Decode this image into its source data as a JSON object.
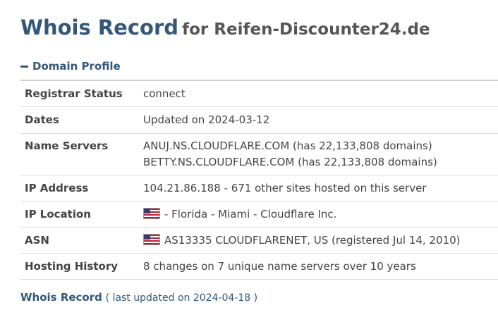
{
  "header": {
    "title": "Whois Record",
    "subtitle": "for Reifen-Discounter24.de"
  },
  "domain_profile": {
    "section_title": "Domain Profile",
    "rows": [
      {
        "key": "Registrar Status",
        "value": "connect"
      },
      {
        "key": "Dates",
        "value": "Updated on 2024-03-12"
      },
      {
        "key": "Name Servers",
        "values": [
          "ANUJ.NS.CLOUDFLARE.COM (has 22,133,808 domains)",
          "BETTY.NS.CLOUDFLARE.COM (has 22,133,808 domains)"
        ]
      },
      {
        "key": "IP Address",
        "value": "104.21.86.188 - 671 other sites hosted on this server"
      },
      {
        "key": "IP Location",
        "value": "- Florida - Miami - Cloudflare Inc.",
        "flag": "us-flag-icon"
      },
      {
        "key": "ASN",
        "value": "AS13335 CLOUDFLARENET, US (registered Jul 14, 2010)",
        "flag": "us-flag-icon"
      },
      {
        "key": "Hosting History",
        "value": "8 changes on 7 unique name servers over 10 years"
      }
    ]
  },
  "whois_record": {
    "label": "Whois Record",
    "note": "( last updated on 2024-04-18 )"
  },
  "colors": {
    "accent": "#34577a",
    "text": "#444444",
    "border": "#dcdcdc"
  }
}
